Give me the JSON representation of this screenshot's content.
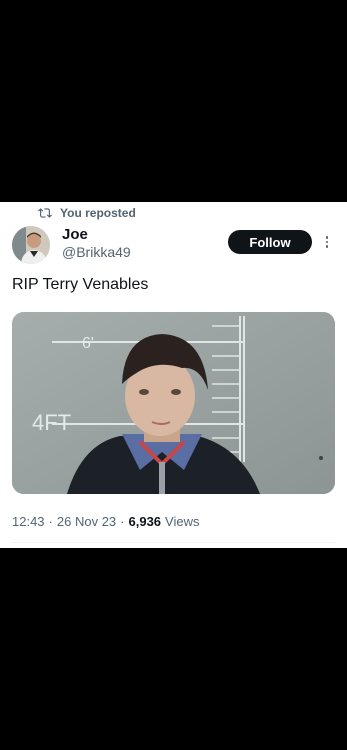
{
  "repost": {
    "label": "You reposted",
    "icon": "repost-icon"
  },
  "author": {
    "name": "Joe",
    "handle": "@Brikka49",
    "avatar_icon": "user-avatar"
  },
  "follow_button": {
    "label": "Follow"
  },
  "more_icon": "more-vertical-icon",
  "tweet": {
    "text": "RIP Terry Venables"
  },
  "media": {
    "height_markers": [
      "6'",
      "4FT"
    ],
    "description_icon": "photo"
  },
  "meta": {
    "time": "12:43",
    "sep1": "·",
    "date": "26 Nov 23",
    "sep2": "·",
    "views_count": "6,936",
    "views_label": "Views"
  },
  "colors": {
    "background": "#000000",
    "card": "#ffffff",
    "text_primary": "#0f1419",
    "text_secondary": "#536471",
    "button": "#0f1419"
  }
}
